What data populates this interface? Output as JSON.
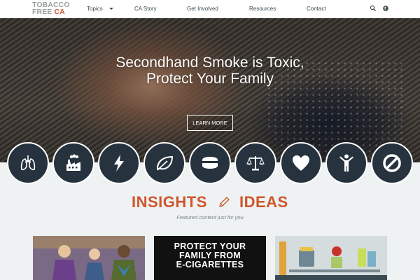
{
  "logo": {
    "line1": "TOBACCO",
    "line2a": "FREE ",
    "line2b": "CA"
  },
  "nav": {
    "items": [
      "Topics",
      "CA Story",
      "Get Involved",
      "Resources",
      "Contact"
    ],
    "icons": [
      "search-icon",
      "globe-icon"
    ]
  },
  "hero": {
    "title_line1": "Secondhand Smoke is Toxic,",
    "title_line2": "Protect Your Family",
    "button": "LEARN MORE"
  },
  "topics_icons": [
    "lungs-icon",
    "factory-icon",
    "lightning-icon",
    "leaf-icon",
    "tin-icon",
    "scales-icon",
    "heart-icon",
    "person-icon",
    "no-icon"
  ],
  "insights": {
    "left": "INSIGHTS",
    "right": "IDEAS",
    "tagline": "Featured content just for you"
  },
  "cards": {
    "card2_line1": "PROTECT YOUR",
    "card2_line2": "FAMILY FROM",
    "card2_line3": "E-CIGARETTES"
  },
  "colors": {
    "accent": "#d0562b",
    "dark": "#26323d",
    "bg": "#eef2f3"
  }
}
